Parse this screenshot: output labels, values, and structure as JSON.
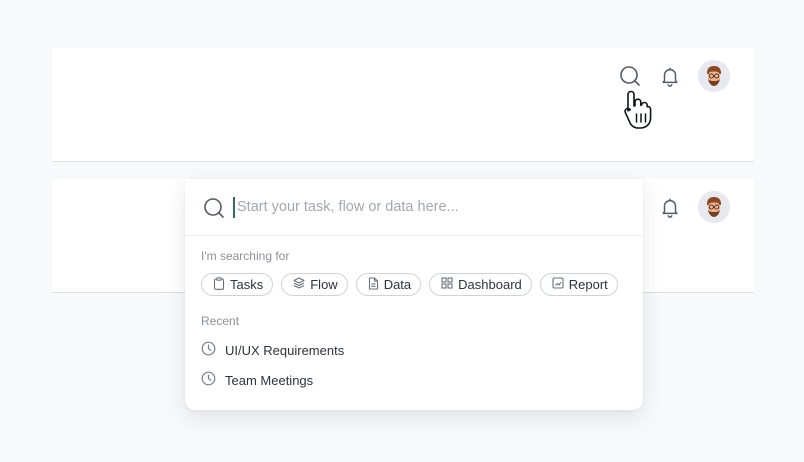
{
  "search": {
    "placeholder": "Start your task, flow or data here...",
    "value": ""
  },
  "searching_for": {
    "label": "I'm searching for",
    "chips": [
      {
        "label": "Tasks",
        "icon": "clipboard-icon"
      },
      {
        "label": "Flow",
        "icon": "layers-icon"
      },
      {
        "label": "Data",
        "icon": "document-icon"
      },
      {
        "label": "Dashboard",
        "icon": "grid-icon"
      },
      {
        "label": "Report",
        "icon": "report-icon"
      }
    ]
  },
  "recent": {
    "label": "Recent",
    "items": [
      {
        "label": "UI/UX Requirements",
        "icon": "clock-icon"
      },
      {
        "label": "Team Meetings",
        "icon": "clock-icon"
      }
    ]
  },
  "colors": {
    "background": "#f8f9fb",
    "caret": "#2f6f6b",
    "border": "#cfd3d9",
    "muted_text": "#8b9199"
  }
}
